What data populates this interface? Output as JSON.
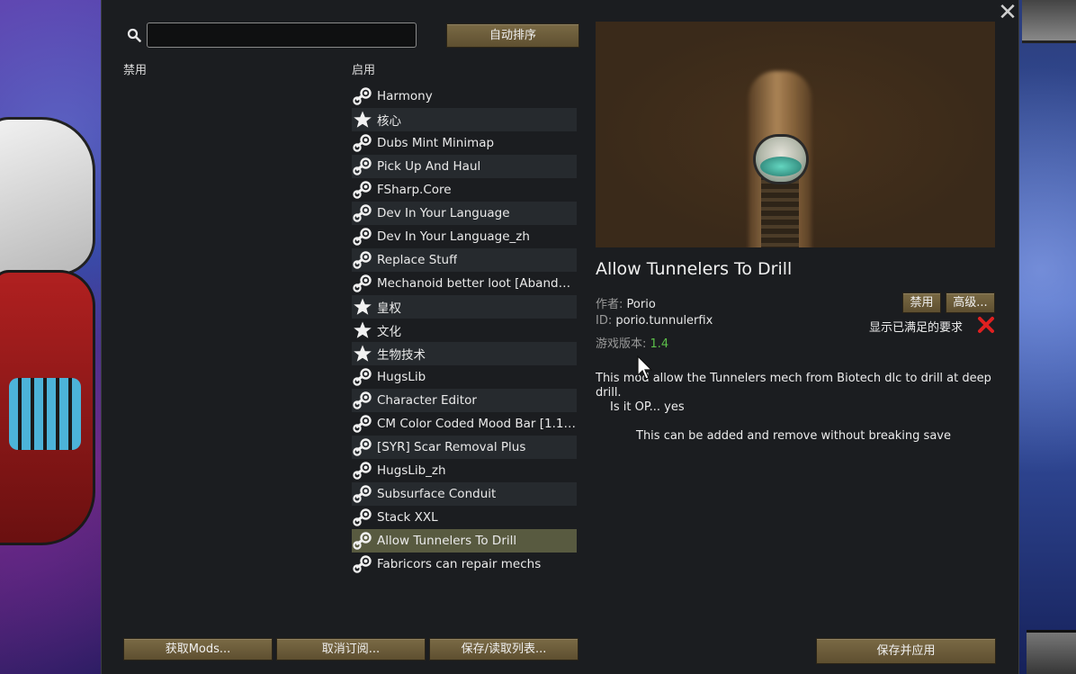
{
  "search": {
    "placeholder": "",
    "value": ""
  },
  "toolbar": {
    "auto_sort_label": "自动排序"
  },
  "columns": {
    "disabled_label": "禁用",
    "enabled_label": "启用"
  },
  "mods": [
    {
      "label": "Harmony",
      "icon": "steam-icon"
    },
    {
      "label": "核心",
      "icon": "star-icon"
    },
    {
      "label": "Dubs Mint Minimap",
      "icon": "steam-icon"
    },
    {
      "label": "Pick Up And Haul",
      "icon": "steam-icon"
    },
    {
      "label": "FSharp.Core",
      "icon": "steam-icon"
    },
    {
      "label": "Dev In Your Language",
      "icon": "steam-icon"
    },
    {
      "label": "Dev In Your Language_zh",
      "icon": "steam-icon"
    },
    {
      "label": "Replace Stuff",
      "icon": "steam-icon"
    },
    {
      "label": "Mechanoid better loot [Abandon...",
      "icon": "steam-icon"
    },
    {
      "label": "皇权",
      "icon": "star-icon"
    },
    {
      "label": "文化",
      "icon": "star-icon"
    },
    {
      "label": "生物技术",
      "icon": "star-icon"
    },
    {
      "label": "HugsLib",
      "icon": "steam-icon"
    },
    {
      "label": "Character Editor",
      "icon": "steam-icon"
    },
    {
      "label": "CM Color Coded Mood Bar [1.1+]",
      "icon": "steam-icon"
    },
    {
      "label": "[SYR] Scar Removal Plus",
      "icon": "steam-icon"
    },
    {
      "label": "HugsLib_zh",
      "icon": "steam-icon"
    },
    {
      "label": "Subsurface Conduit",
      "icon": "steam-icon"
    },
    {
      "label": "Stack XXL",
      "icon": "steam-icon"
    },
    {
      "label": "Allow Tunnelers To Drill",
      "icon": "steam-icon",
      "selected": true
    },
    {
      "label": "Fabricors can repair mechs",
      "icon": "steam-icon"
    }
  ],
  "detail": {
    "title": "Allow Tunnelers To Drill",
    "author_key": "作者:",
    "author_value": "Porio",
    "id_key": "ID:",
    "id_value": "porio.tunnulerfix",
    "version_key": "游戏版本:",
    "version_value": "1.4",
    "disable_label": "禁用",
    "advanced_label": "高级...",
    "requirements_label": "显示已满足的要求",
    "description_line1": "This mod allow the Tunnelers mech from Biotech dlc to drill at deep drill.",
    "description_line2": "Is it OP... yes",
    "description_line3": "This can be added and remove without breaking save"
  },
  "footer": {
    "get_mods_label": "获取Mods...",
    "unsubscribe_label": "取消订阅...",
    "save_load_label": "保存/读取列表...",
    "save_apply_label": "保存并应用"
  },
  "colors": {
    "panel_bg": "#1b1d20",
    "button_bg": "#6b5b3a",
    "selected_row": "#585a40",
    "version_green": "#5cc04a",
    "error_red": "#e02020"
  }
}
